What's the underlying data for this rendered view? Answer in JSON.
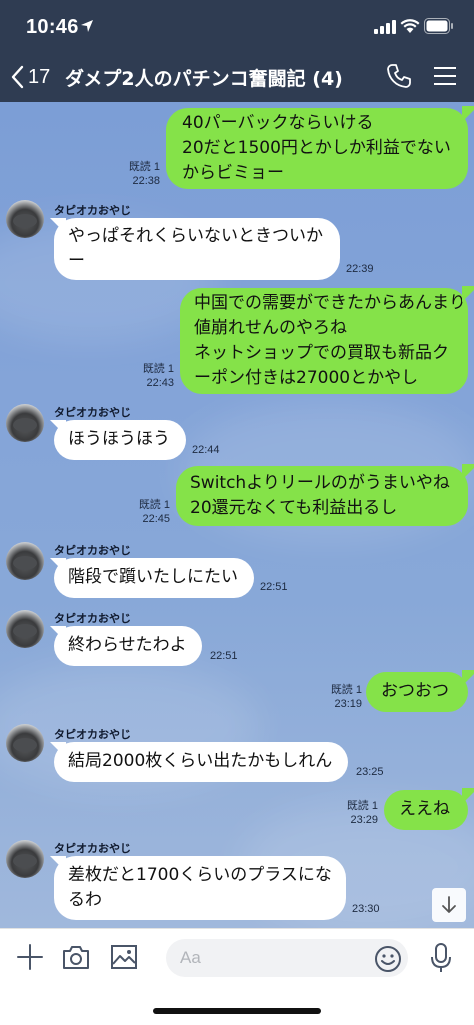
{
  "status_bar": {
    "time": "10:46"
  },
  "header": {
    "back_count": "17",
    "title": "ダメプ2人のパチンコ奮闘記 (4)"
  },
  "colors": {
    "header_bg": "#2f3c52",
    "outgoing_bubble": "#85e249",
    "incoming_bubble": "#ffffff",
    "chat_bg": "#84a4d8"
  },
  "messages": [
    {
      "side": "out",
      "text": "40パーバックならいける\n20だと1500円とかしか利益でない\nからビミョー",
      "read": "既読 1",
      "time": "22:38"
    },
    {
      "side": "in",
      "sender": "タピオカおやじ",
      "text": "やっぱそれくらいないときついか\nー",
      "time": "22:39"
    },
    {
      "side": "out",
      "text": "中国での需要ができたからあんまり\n値崩れせんのやろね\nネットショップでの買取も新品ク\nーポン付きは27000とかやし",
      "read": "既読 1",
      "time": "22:43"
    },
    {
      "side": "in",
      "sender": "タピオカおやじ",
      "text": "ほうほうほう",
      "time": "22:44"
    },
    {
      "side": "out",
      "text": "Switchよりリールのがうまいやね\n20還元なくても利益出るし",
      "read": "既読 1",
      "time": "22:45"
    },
    {
      "side": "in",
      "sender": "タピオカおやじ",
      "text": "階段で躓いたしにたい",
      "time": "22:51"
    },
    {
      "side": "in",
      "sender": "タピオカおやじ",
      "text": "終わらせたわよ",
      "time": "22:51"
    },
    {
      "side": "out",
      "text": "おつおつ",
      "read": "既読 1",
      "time": "23:19"
    },
    {
      "side": "in",
      "sender": "タピオカおやじ",
      "text": "結局2000枚くらい出たかもしれん",
      "time": "23:25"
    },
    {
      "side": "out",
      "text": "ええね",
      "read": "既読 1",
      "time": "23:29"
    },
    {
      "side": "in",
      "sender": "タピオカおやじ",
      "text": "差枚だと1700くらいのプラスにな\nるわ",
      "time": "23:30"
    }
  ],
  "input": {
    "placeholder": "Aa"
  },
  "icons": {
    "back": "chevron-left-icon",
    "call": "phone-icon",
    "menu": "hamburger-menu-icon",
    "add": "plus-icon",
    "camera": "camera-icon",
    "image": "image-icon",
    "emoji": "emoji-icon",
    "mic": "microphone-icon",
    "scroll": "arrow-down-icon"
  }
}
